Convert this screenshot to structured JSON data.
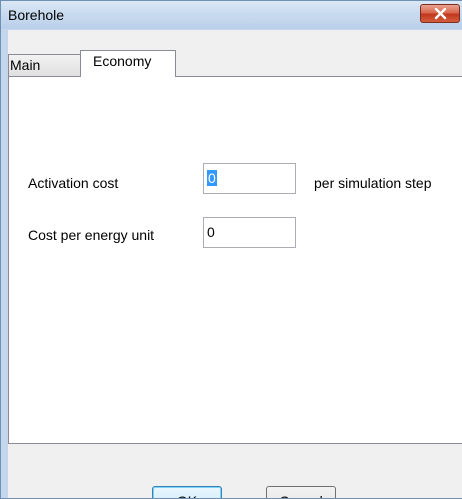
{
  "window": {
    "title": "Borehole"
  },
  "tabs": [
    {
      "label": "Main",
      "selected": false
    },
    {
      "label": "Economy",
      "selected": true
    }
  ],
  "economy": {
    "activation_cost": {
      "label": "Activation cost",
      "value": "0",
      "suffix": "per simulation step"
    },
    "cost_per_energy_unit": {
      "label": "Cost per energy unit",
      "value": "0"
    }
  },
  "buttons": {
    "ok_label": "OK",
    "cancel_label": "Cancel"
  },
  "icons": {
    "close": "close-icon"
  },
  "colors": {
    "titlebar": "#c3d6ec",
    "close_button": "#c2371c",
    "selection": "#3399ff",
    "default_button_border": "#3c7fb1"
  }
}
